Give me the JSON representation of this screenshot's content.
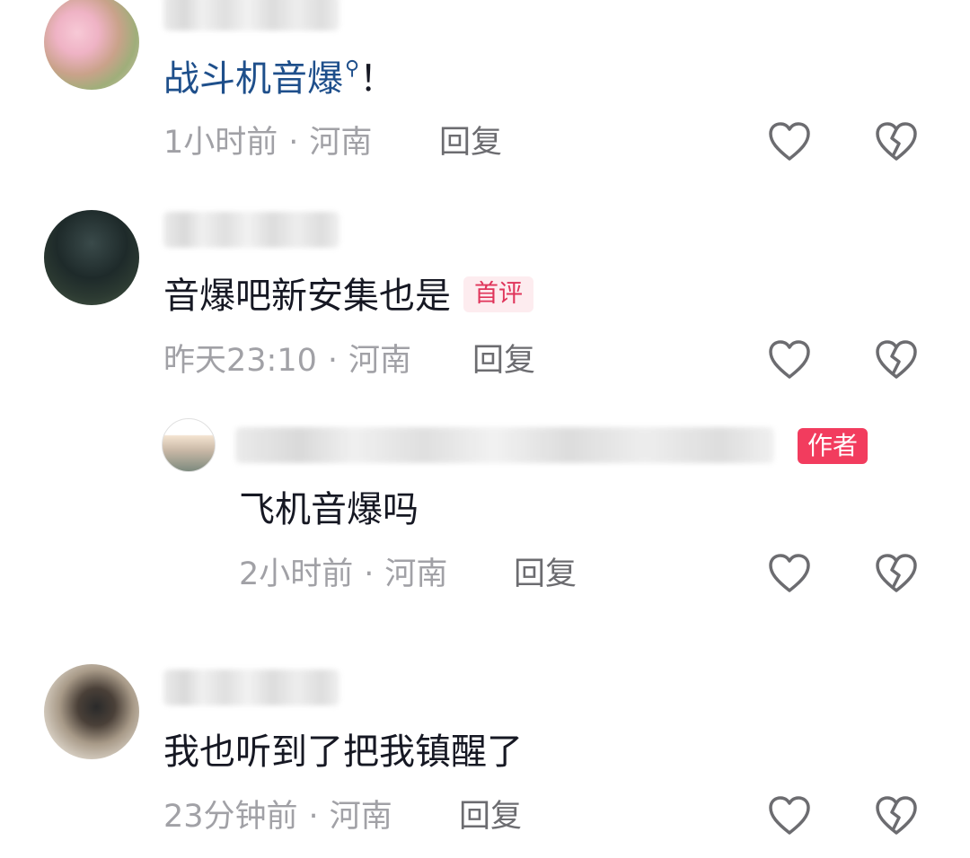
{
  "comments": [
    {
      "username": "",
      "text": "战斗机音爆",
      "search_marker": "⚲",
      "text_suffix": "！",
      "time": "1小时前",
      "location": "河南",
      "reply_label": "回复"
    },
    {
      "username": "",
      "text": "音爆吧新安集也是",
      "tag": "首评",
      "time": "昨天23:10",
      "location": "河南",
      "reply_label": "回复",
      "replies": [
        {
          "username": "",
          "badge": "作者",
          "text": "飞机音爆吗",
          "time": "2小时前",
          "location": "河南",
          "reply_label": "回复"
        }
      ]
    },
    {
      "username": "",
      "text": "我也听到了把我镇醒了",
      "time": "23分钟前",
      "location": "河南",
      "reply_label": "回复"
    }
  ],
  "separator": "·",
  "icons": {
    "like": "heart-icon",
    "dislike": "broken-heart-icon"
  },
  "colors": {
    "link": "#1e4f8b",
    "meta": "#a1a1a6",
    "author_badge": "#f23c5e",
    "first_tag": "#e0345a"
  }
}
